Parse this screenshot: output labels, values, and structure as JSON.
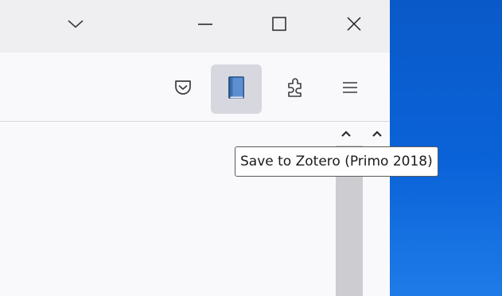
{
  "titlebar": {
    "buttons": [
      {
        "name": "list-all-tabs",
        "icon": "chevron-down-icon"
      },
      {
        "name": "minimize",
        "icon": "minimize-icon"
      },
      {
        "name": "maximize",
        "icon": "maximize-icon"
      },
      {
        "name": "close",
        "icon": "close-icon"
      }
    ]
  },
  "toolbar": {
    "buttons": [
      {
        "name": "pocket",
        "icon": "pocket-icon"
      },
      {
        "name": "zotero-connector",
        "icon": "zotero-book-icon",
        "active": true
      },
      {
        "name": "extensions",
        "icon": "puzzle-piece-icon"
      },
      {
        "name": "app-menu",
        "icon": "hamburger-menu-icon"
      }
    ]
  },
  "tooltip": {
    "text": "Save to Zotero (Primo 2018)"
  },
  "colors": {
    "desktop": "#0a59c8",
    "titlebar": "#efeff2",
    "toolbar": "#f9f9fb",
    "active_button": "#d7d7df",
    "book_blue": "#3d6fb0",
    "scrollbar_track": "#cdcdd1"
  }
}
